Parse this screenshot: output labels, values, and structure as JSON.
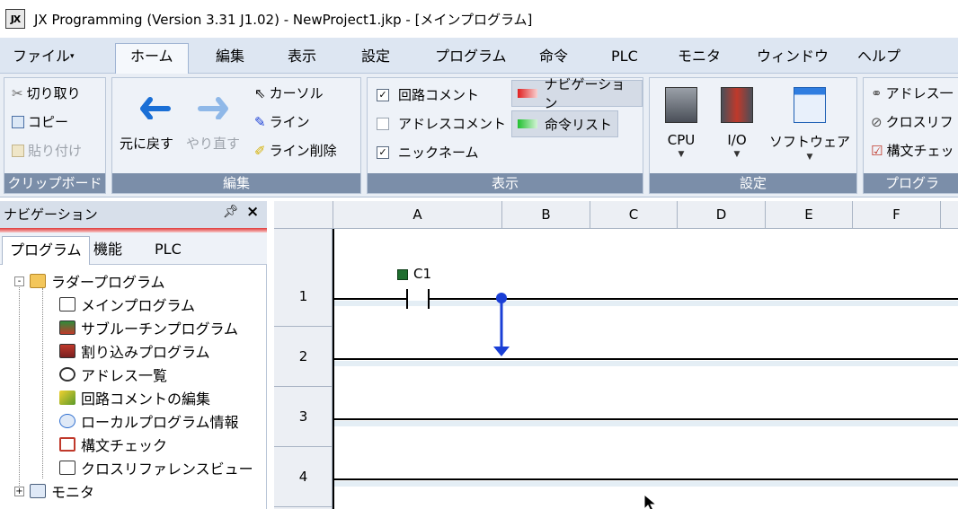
{
  "window": {
    "icon_text": "JX",
    "title": "JX Programming (Version 3.31 J1.02) - NewProject1.jkp - [メインプログラム]"
  },
  "menu": {
    "tabs": [
      "ファイル",
      "ホーム",
      "編集",
      "表示",
      "設定",
      "プログラム",
      "命令",
      "PLC",
      "モニタ",
      "ウィンドウ",
      "ヘルプ"
    ],
    "active": "ホーム"
  },
  "ribbon": {
    "clipboard": {
      "cut": "切り取り",
      "copy": "コピー",
      "paste": "貼り付け",
      "label": "クリップボード"
    },
    "edit": {
      "undo": "元に戻す",
      "redo": "やり直す",
      "cursor": "カーソル",
      "line": "ライン",
      "line_delete": "ライン削除",
      "label": "編集"
    },
    "view": {
      "circuit_comment": "回路コメント",
      "address_comment": "アドレスコメント",
      "nickname": "ニックネーム",
      "navigation": "ナビゲーション",
      "instruction_list": "命令リスト",
      "label": "表示",
      "circuit_comment_checked": true,
      "address_comment_checked": false,
      "nickname_checked": true
    },
    "settings": {
      "cpu": "CPU",
      "io": "I/O",
      "software": "ソフトウェア",
      "label": "設定"
    },
    "program": {
      "address": "アドレス一",
      "cross": "クロスリフ",
      "syntax": "構文チェッ",
      "label": "プログラ"
    }
  },
  "navigation": {
    "title": "ナビゲーション",
    "pin": "ᵖ",
    "close": "×",
    "tabs": [
      "プログラム",
      "機能",
      "PLC"
    ],
    "active_tab": "プログラム",
    "tree": [
      {
        "label": "ラダープログラム",
        "icon": "folder-icon",
        "expander": "-"
      },
      {
        "label": "メインプログラム",
        "icon": "main-program-icon"
      },
      {
        "label": "サブルーチンプログラム",
        "icon": "subroutine-icon"
      },
      {
        "label": "割り込みプログラム",
        "icon": "interrupt-icon"
      },
      {
        "label": "アドレス一覧",
        "icon": "address-list-icon"
      },
      {
        "label": "回路コメントの編集",
        "icon": "comment-edit-icon"
      },
      {
        "label": "ローカルプログラム情報",
        "icon": "info-icon"
      },
      {
        "label": "構文チェック",
        "icon": "syntax-check-icon"
      },
      {
        "label": "クロスリファレンスビュー",
        "icon": "cross-reference-icon"
      },
      {
        "label": "モニタ",
        "icon": "monitor-icon",
        "expander": "+"
      }
    ]
  },
  "editor": {
    "columns": [
      "A",
      "B",
      "C",
      "D",
      "E",
      "F"
    ],
    "rows": [
      "1",
      "2",
      "3",
      "4"
    ],
    "contact_label": "C1"
  },
  "colors": {
    "accent_blue": "#1a3fd6",
    "group_label_bg": "#7b8ea9",
    "navigation_swatch": "#e02020",
    "instruction_swatch": "#22c030"
  }
}
